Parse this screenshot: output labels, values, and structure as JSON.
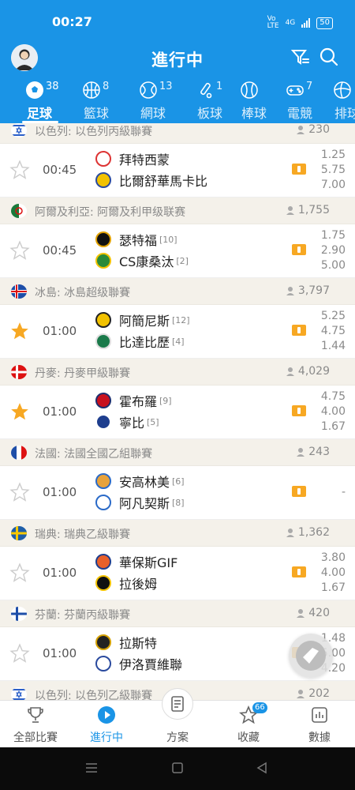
{
  "status": {
    "time": "00:27",
    "net_top": "Vo",
    "net_mid": "4G",
    "net_bot": "LTE",
    "battery": "50"
  },
  "header": {
    "title": "進行中"
  },
  "colors": {
    "brand": "#1a94e6",
    "league_bg": "#f4f1ea",
    "star_active": "#f7a823",
    "live": "#f7a823"
  },
  "tabs": [
    {
      "label": "足球",
      "count": "38",
      "icon": "soccer-ball-icon",
      "active": true
    },
    {
      "label": "籃球",
      "count": "8",
      "icon": "basketball-icon"
    },
    {
      "label": "網球",
      "count": "13",
      "icon": "tennis-icon"
    },
    {
      "label": "板球",
      "count": "1",
      "icon": "cricket-icon"
    },
    {
      "label": "棒球",
      "count": "",
      "icon": "baseball-icon"
    },
    {
      "label": "電競",
      "count": "7",
      "icon": "esports-icon"
    },
    {
      "label": "排球",
      "count": "",
      "icon": "volleyball-icon"
    }
  ],
  "leagues": [
    {
      "flag": "israel",
      "name": "以色列: 以色列丙級聯賽",
      "count": "230",
      "match": {
        "starred": false,
        "time": "00:45",
        "home": "拜特西蒙",
        "home_rank": "",
        "away": "比爾舒華馬卡比",
        "away_rank": "",
        "odds": [
          "1.25",
          "5.75",
          "7.00"
        ]
      }
    },
    {
      "flag": "algeria",
      "name": "阿爾及利亞: 阿爾及利甲级联赛",
      "count": "1,755",
      "match": {
        "starred": false,
        "time": "00:45",
        "home": "瑟特福",
        "home_rank": "[10]",
        "away": "CS康桑汰",
        "away_rank": "[2]",
        "odds": [
          "1.75",
          "2.90",
          "5.00"
        ]
      }
    },
    {
      "flag": "iceland",
      "name": "冰島: 冰島超级聯賽",
      "count": "3,797",
      "match": {
        "starred": true,
        "time": "01:00",
        "home": "阿簡尼斯",
        "home_rank": "[12]",
        "away": "比達比歷",
        "away_rank": "[4]",
        "odds": [
          "5.25",
          "4.75",
          "1.44"
        ]
      }
    },
    {
      "flag": "denmark",
      "name": "丹麥: 丹麥甲級聯賽",
      "count": "4,029",
      "match": {
        "starred": true,
        "time": "01:00",
        "home": "霍布羅",
        "home_rank": "[9]",
        "away": "寧比",
        "away_rank": "[5]",
        "odds": [
          "4.75",
          "4.00",
          "1.67"
        ]
      }
    },
    {
      "flag": "france",
      "name": "法國: 法國全國乙組聯賽",
      "count": "243",
      "match": {
        "starred": false,
        "time": "01:00",
        "home": "安高林美",
        "home_rank": "[6]",
        "away": "阿凡契斯",
        "away_rank": "[8]",
        "odds": [
          "-"
        ]
      }
    },
    {
      "flag": "sweden",
      "name": "瑞典: 瑞典乙級聯賽",
      "count": "1,362",
      "match": {
        "starred": false,
        "time": "01:00",
        "home": "華保斯GIF",
        "home_rank": "",
        "away": "拉後姆",
        "away_rank": "",
        "odds": [
          "3.80",
          "4.00",
          "1.67"
        ]
      }
    },
    {
      "flag": "finland",
      "name": "芬蘭: 芬蘭丙級聯賽",
      "count": "420",
      "match": {
        "starred": false,
        "time": "01:00",
        "home": "拉斯特",
        "home_rank": "",
        "away": "伊洛賈維聯",
        "away_rank": "",
        "odds": [
          "1.48",
          "5.00",
          "4.20"
        ]
      }
    },
    {
      "flag": "israel",
      "name": "以色列: 以色列乙級聯賽",
      "count": "202"
    }
  ],
  "bottom_nav": [
    {
      "label": "全部比賽",
      "icon": "trophy-icon"
    },
    {
      "label": "進行中",
      "icon": "play-circle-icon",
      "active": true
    },
    {
      "label": "方案",
      "icon": "document-icon"
    },
    {
      "label": "收藏",
      "icon": "star-outline-icon",
      "badge": "66"
    },
    {
      "label": "數據",
      "icon": "bar-chart-icon"
    }
  ]
}
